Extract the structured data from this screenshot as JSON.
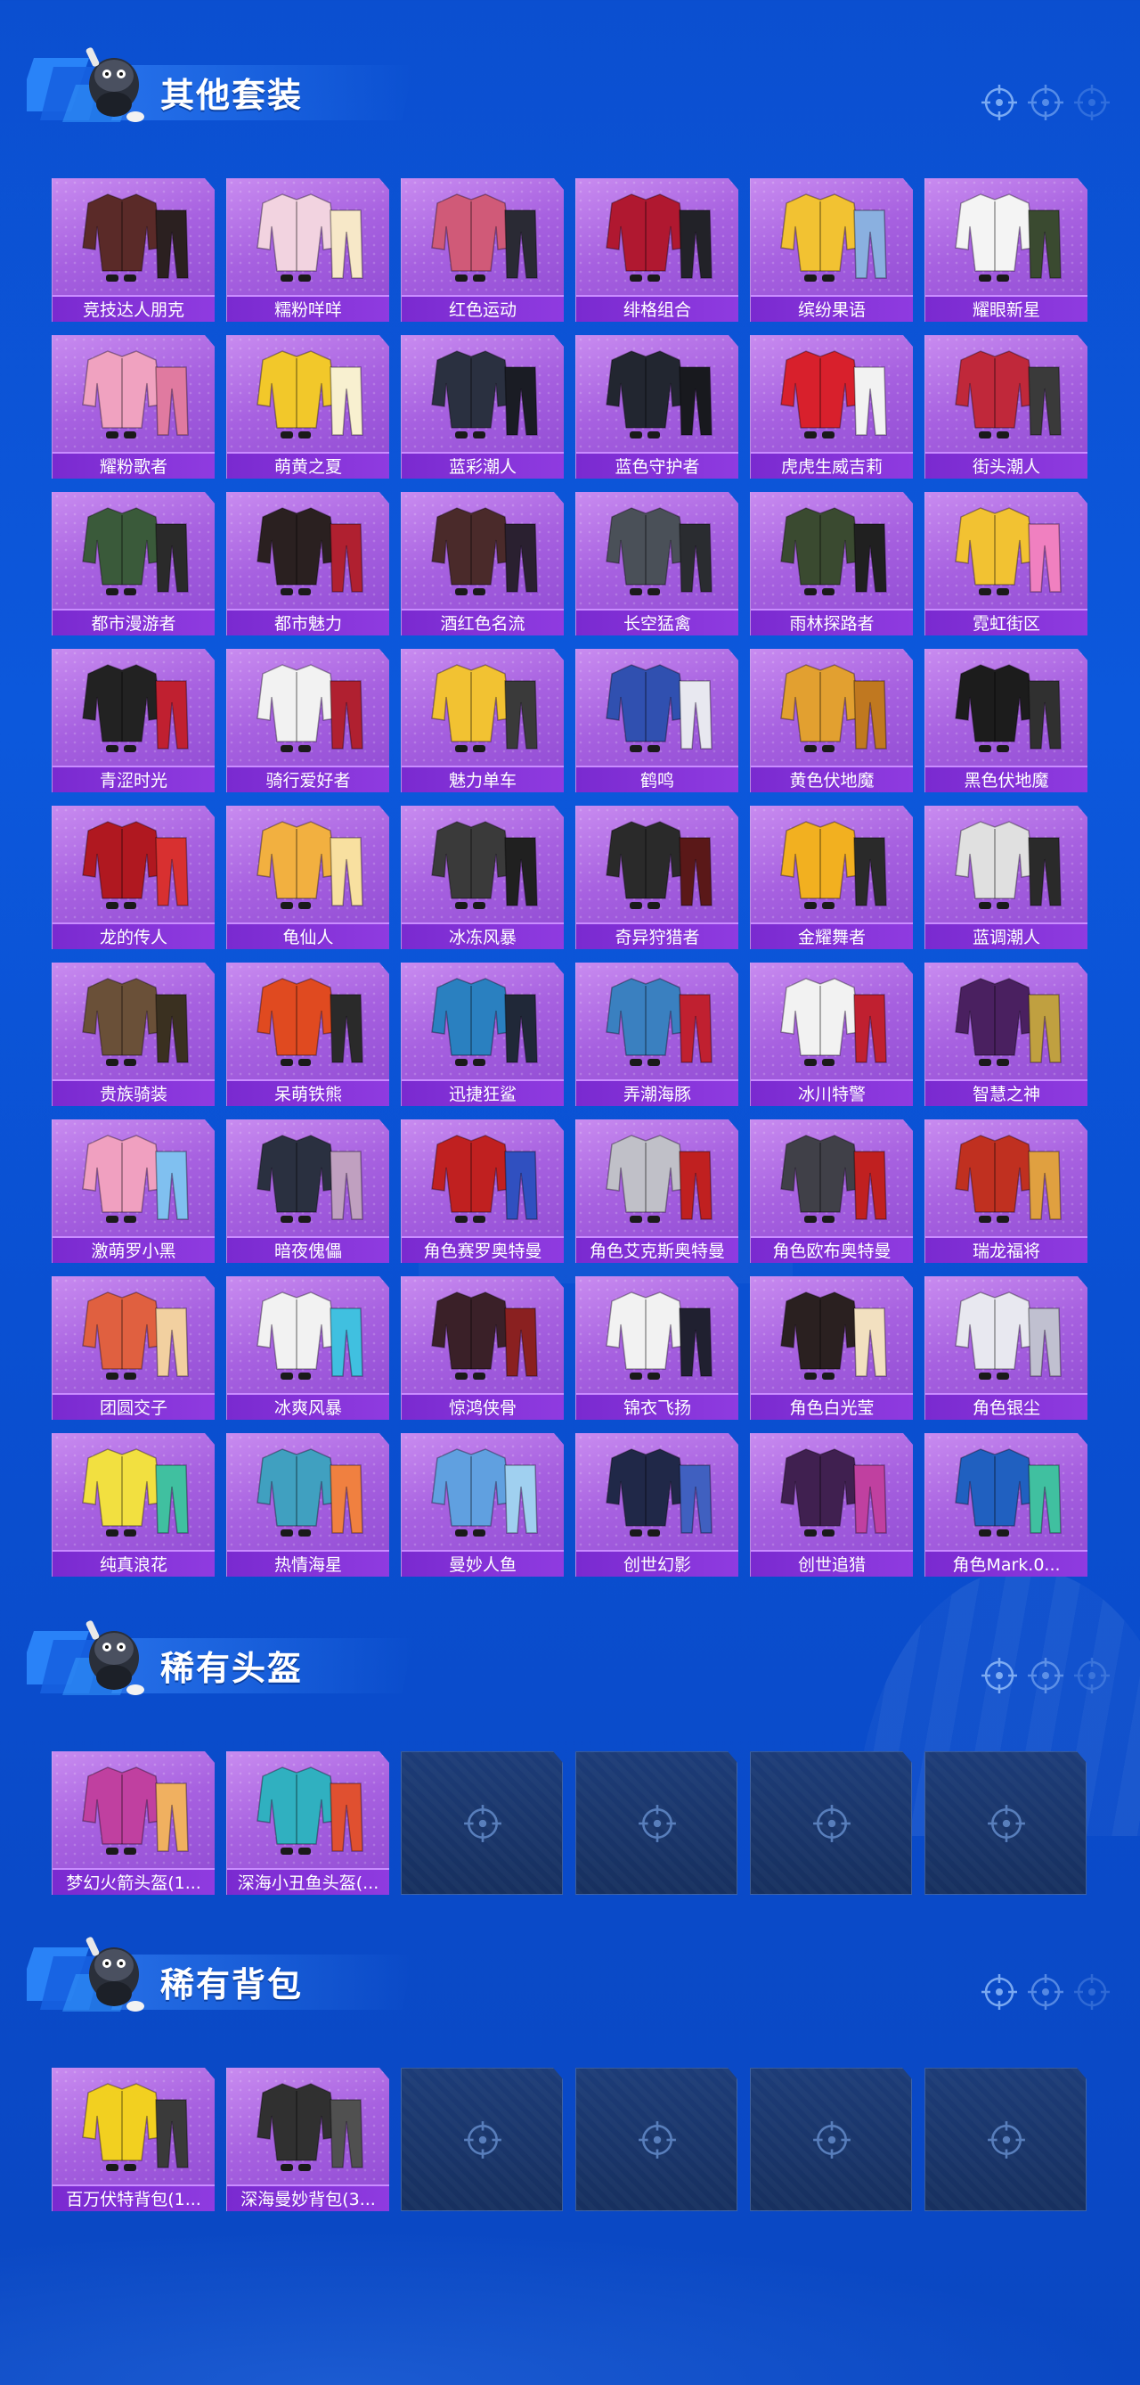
{
  "sections": [
    {
      "title": "其他套装",
      "items": [
        {
          "label": "竞技达人朋克",
          "colors": [
            "#5a2a28",
            "#2b2020"
          ]
        },
        {
          "label": "糯粉咩咩",
          "colors": [
            "#f2d3e0",
            "#f7e8c8"
          ]
        },
        {
          "label": "红色运动",
          "colors": [
            "#d05a78",
            "#2a2a34"
          ]
        },
        {
          "label": "绯格组合",
          "colors": [
            "#b01830",
            "#222228"
          ]
        },
        {
          "label": "缤纷果语",
          "colors": [
            "#f2c232",
            "#8ab0e0"
          ]
        },
        {
          "label": "耀眼新星",
          "colors": [
            "#f4f4f4",
            "#3a4a30"
          ]
        },
        {
          "label": "耀粉歌者",
          "colors": [
            "#f0a2c0",
            "#e07aa0"
          ]
        },
        {
          "label": "萌黄之夏",
          "colors": [
            "#f2c82a",
            "#f8f0d0"
          ]
        },
        {
          "label": "蓝彩潮人",
          "colors": [
            "#2a3040",
            "#1a1c24"
          ]
        },
        {
          "label": "蓝色守护者",
          "colors": [
            "#222630",
            "#18191e"
          ]
        },
        {
          "label": "虎虎生威吉莉",
          "colors": [
            "#d8202c",
            "#f2f2f2"
          ]
        },
        {
          "label": "街头潮人",
          "colors": [
            "#c0283a",
            "#3a3a3a"
          ]
        },
        {
          "label": "都市漫游者",
          "colors": [
            "#3a5a3a",
            "#2a2a2a"
          ]
        },
        {
          "label": "都市魅力",
          "colors": [
            "#2a2020",
            "#b02030"
          ]
        },
        {
          "label": "酒红色名流",
          "colors": [
            "#4a2a2a",
            "#2a2030"
          ]
        },
        {
          "label": "长空猛禽",
          "colors": [
            "#4a5058",
            "#2a2c30"
          ]
        },
        {
          "label": "雨林探路者",
          "colors": [
            "#3a4a30",
            "#202020"
          ]
        },
        {
          "label": "霓虹街区",
          "colors": [
            "#f2c232",
            "#f080c0"
          ]
        },
        {
          "label": "青涩时光",
          "colors": [
            "#222222",
            "#c02030"
          ]
        },
        {
          "label": "骑行爱好者",
          "colors": [
            "#f2f2f2",
            "#b02030"
          ]
        },
        {
          "label": "魅力单车",
          "colors": [
            "#f2c232",
            "#3a3a3a"
          ]
        },
        {
          "label": "鹤鸣",
          "colors": [
            "#3050b0",
            "#e8e8f0"
          ]
        },
        {
          "label": "黄色伏地魔",
          "colors": [
            "#e2a030",
            "#c07820"
          ]
        },
        {
          "label": "黑色伏地魔",
          "colors": [
            "#1c1c1c",
            "#303030"
          ]
        },
        {
          "label": "龙的传人",
          "colors": [
            "#b01820",
            "#d83030"
          ]
        },
        {
          "label": "龟仙人",
          "colors": [
            "#f2b040",
            "#f8e0a0"
          ]
        },
        {
          "label": "冰冻风暴",
          "colors": [
            "#3a3a3a",
            "#202020"
          ]
        },
        {
          "label": "奇异狩猎者",
          "colors": [
            "#2a2a2a",
            "#5a1818"
          ]
        },
        {
          "label": "金耀舞者",
          "colors": [
            "#f2b020",
            "#2a2a2a"
          ]
        },
        {
          "label": "蓝调潮人",
          "colors": [
            "#e0e0e0",
            "#2a2a2a"
          ]
        },
        {
          "label": "贵族骑装",
          "colors": [
            "#6a5038",
            "#3a3020"
          ]
        },
        {
          "label": "呆萌铁熊",
          "colors": [
            "#e04a20",
            "#2a2a2a"
          ]
        },
        {
          "label": "迅捷狂鲨",
          "colors": [
            "#2a80c0",
            "#202838"
          ]
        },
        {
          "label": "弄潮海豚",
          "colors": [
            "#3a80c0",
            "#c02030"
          ]
        },
        {
          "label": "冰川特警",
          "colors": [
            "#f2f2f2",
            "#c02030"
          ]
        },
        {
          "label": "智慧之神",
          "colors": [
            "#4a2060",
            "#c0a040"
          ]
        },
        {
          "label": "激萌罗小黑",
          "colors": [
            "#f0a0c0",
            "#80c0f0"
          ]
        },
        {
          "label": "暗夜傀儡",
          "colors": [
            "#2a3040",
            "#c0a0c0"
          ]
        },
        {
          "label": "角色赛罗奥特曼",
          "colors": [
            "#c02020",
            "#3050c0"
          ]
        },
        {
          "label": "角色艾克斯奥特曼",
          "colors": [
            "#c0c0c8",
            "#c02020"
          ]
        },
        {
          "label": "角色欧布奥特曼",
          "colors": [
            "#404048",
            "#c02020"
          ]
        },
        {
          "label": "瑞龙福将",
          "colors": [
            "#c03020",
            "#e0a040"
          ]
        },
        {
          "label": "团圆交子",
          "colors": [
            "#e06040",
            "#f2d0a0"
          ]
        },
        {
          "label": "冰爽风暴",
          "colors": [
            "#f2f2f2",
            "#40c0e0"
          ]
        },
        {
          "label": "惊鸿侠骨",
          "colors": [
            "#3a2028",
            "#8a2020"
          ]
        },
        {
          "label": "锦衣飞扬",
          "colors": [
            "#f2f2f2",
            "#202030"
          ]
        },
        {
          "label": "角色白光莹",
          "colors": [
            "#2a2020",
            "#f2e0c0"
          ]
        },
        {
          "label": "角色银尘",
          "colors": [
            "#e8e8f0",
            "#c0c0d0"
          ]
        },
        {
          "label": "纯真浪花",
          "colors": [
            "#f2e040",
            "#40c0a0"
          ]
        },
        {
          "label": "热情海星",
          "colors": [
            "#40a0c0",
            "#f08040"
          ]
        },
        {
          "label": "曼妙人鱼",
          "colors": [
            "#60a0e0",
            "#a0d0f0"
          ]
        },
        {
          "label": "创世幻影",
          "colors": [
            "#202848",
            "#4060c0"
          ]
        },
        {
          "label": "创世追猎",
          "colors": [
            "#402050",
            "#c040a0"
          ]
        },
        {
          "label": "角色Mark.0...",
          "colors": [
            "#2060c0",
            "#40c0a0"
          ]
        }
      ]
    },
    {
      "title": "稀有头盔",
      "items": [
        {
          "label": "梦幻火箭头盔(1...",
          "colors": [
            "#c040a0",
            "#f0b060"
          ]
        },
        {
          "label": "深海小丑鱼头盔(...",
          "colors": [
            "#30b0c0",
            "#e05030"
          ]
        },
        null,
        null,
        null,
        null
      ]
    },
    {
      "title": "稀有背包",
      "items": [
        {
          "label": "百万伏特背包(1...",
          "colors": [
            "#f2d020",
            "#3a3a3a"
          ]
        },
        {
          "label": "深海曼妙背包(3...",
          "colors": [
            "#303030",
            "#505050"
          ]
        },
        null,
        null,
        null,
        null
      ]
    }
  ]
}
